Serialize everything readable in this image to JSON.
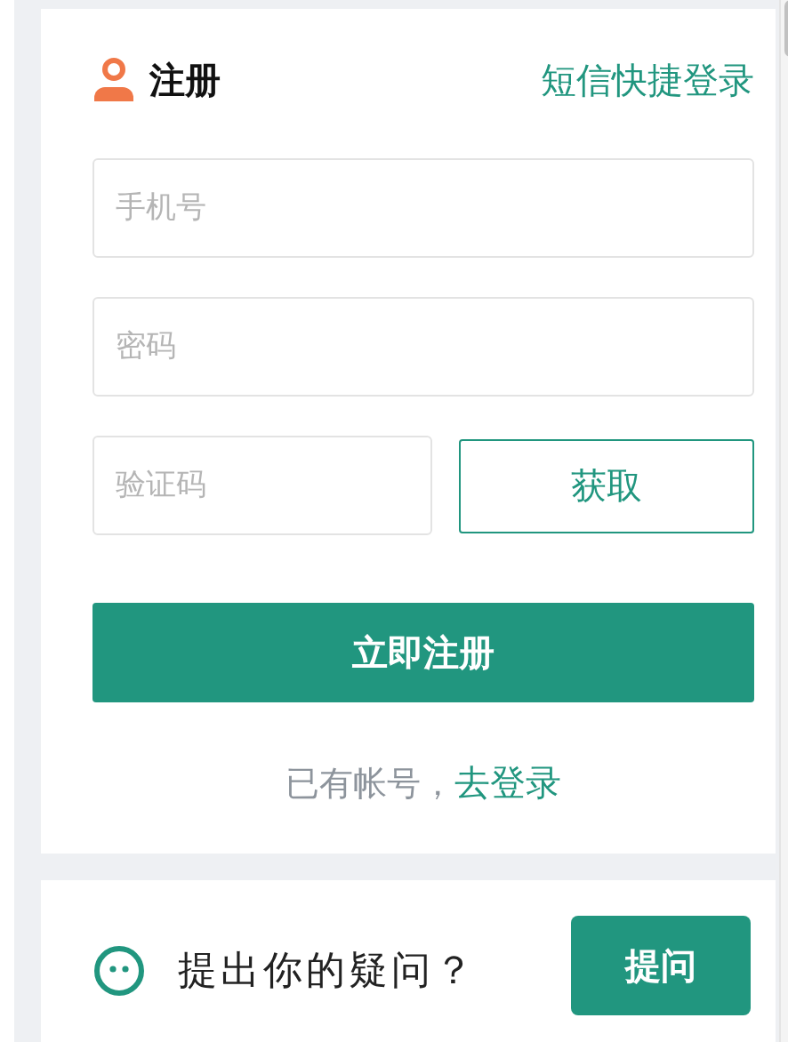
{
  "register_card": {
    "title": "注册",
    "sms_login_link": "短信快捷登录",
    "fields": [
      {
        "placeholder": "手机号"
      },
      {
        "placeholder": "密码"
      }
    ],
    "captcha": {
      "placeholder": "验证码",
      "button": "获取"
    },
    "submit_button": "立即注册",
    "login_prompt": {
      "text": "已有帐号，",
      "link": "去登录"
    }
  },
  "question_card": {
    "text": "提出你的疑问？",
    "button": "提问"
  }
}
